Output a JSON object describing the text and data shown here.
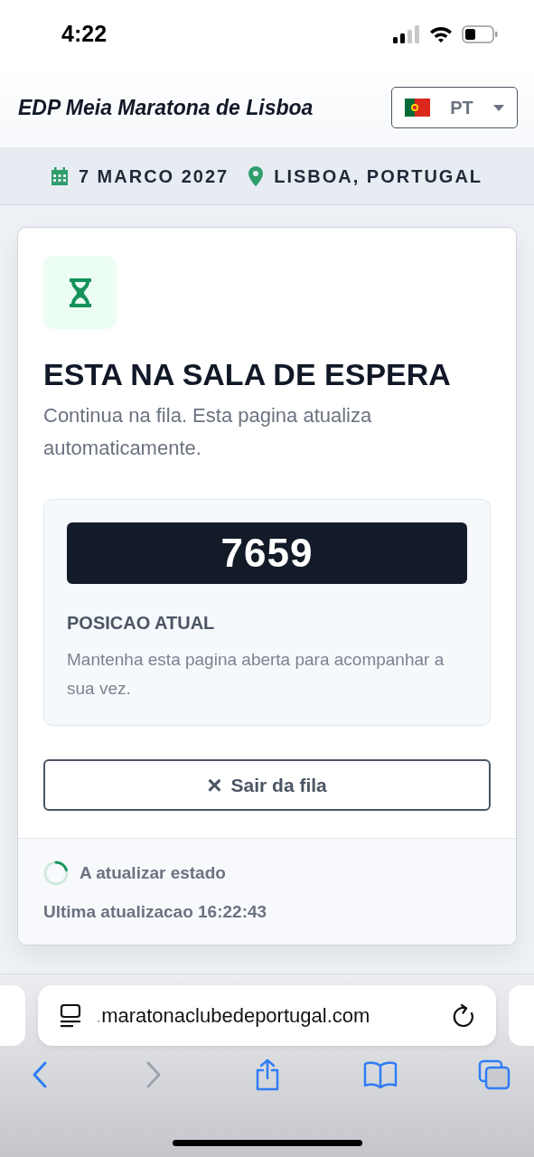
{
  "status_bar": {
    "time": "4:22"
  },
  "header": {
    "title": "EDP Meia Maratona de Lisboa",
    "language": {
      "code": "PT"
    }
  },
  "event_info": {
    "date": "7 MARCO 2027",
    "location": "LISBOA, PORTUGAL"
  },
  "waiting_room": {
    "title": "ESTA NA SALA DE ESPERA",
    "subtitle": "Continua na fila. Esta pagina atualiza automaticamente.",
    "position": {
      "number": "7659",
      "label": "POSICAO ATUAL",
      "hint": "Mantenha esta pagina aberta para acompanhar a sua vez."
    },
    "leave_button": {
      "icon": "×",
      "label": "Sair da fila"
    },
    "footer": {
      "status": "A atualizar estado",
      "last_update": "Ultima atualizacao 16:22:43"
    }
  },
  "browser": {
    "url_prefix": ".",
    "url": "maratonaclubedeportugal.com",
    "back": {
      "disabled": false
    },
    "forward": {
      "disabled": true
    }
  }
}
